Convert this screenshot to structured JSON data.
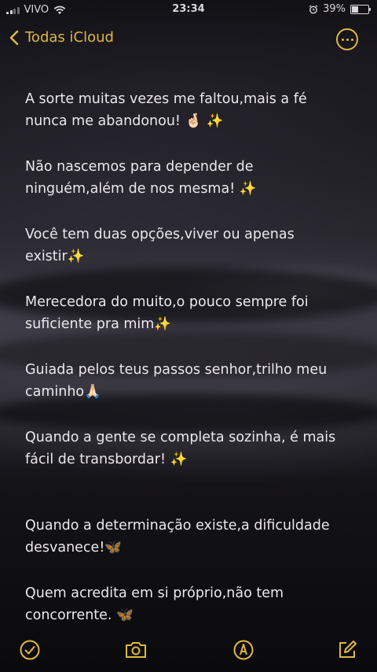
{
  "status_bar": {
    "carrier": "VIVO",
    "time": "23:34",
    "battery_percent": "39%",
    "battery_level": 0.39,
    "icons": [
      "signal-icon",
      "wifi-icon",
      "alarm-icon",
      "battery-icon"
    ]
  },
  "nav": {
    "back_label": "Todas iCloud",
    "more_icon": "ellipsis-circle-icon",
    "accent_color": "#e0b744"
  },
  "note": {
    "paragraphs": [
      "A sorte muitas vezes me faltou,mais a fé\nnunca me abandonou! 🤞🏻 ✨",
      "Não nascemos para depender de\nninguém,além de nos mesma! ✨",
      "Você tem duas opções,viver ou apenas\nexistir✨",
      "Merecedora do muito,o pouco sempre foi\nsuficiente pra mim✨",
      "Guiada pelos teus passos senhor,trilho meu\ncaminho🙏🏻",
      "Quando a gente se completa sozinha, é mais\nfácil de transbordar! ✨",
      "Quando a determinação existe,a dificuldade\ndesvanece!🦋",
      "Quem acredita em si próprio,não tem\nconcorrente. 🦋"
    ]
  },
  "toolbar": {
    "icons": [
      "checklist-icon",
      "camera-icon",
      "markup-icon",
      "compose-icon"
    ]
  }
}
